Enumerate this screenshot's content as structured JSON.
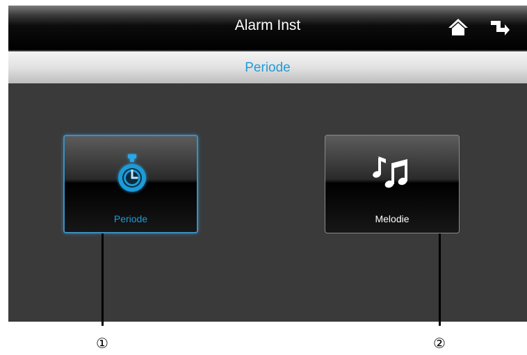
{
  "header": {
    "title": "Alarm Inst",
    "home_icon": "home-icon",
    "back_icon": "return-arrow-icon"
  },
  "subheader": {
    "title": "Periode"
  },
  "tiles": [
    {
      "label": "Periode",
      "icon": "stopwatch-icon",
      "selected": true,
      "accent": "#1e9bd8"
    },
    {
      "label": "Melodie",
      "icon": "music-notes-icon",
      "selected": false
    }
  ],
  "callouts": [
    "①",
    "②"
  ]
}
